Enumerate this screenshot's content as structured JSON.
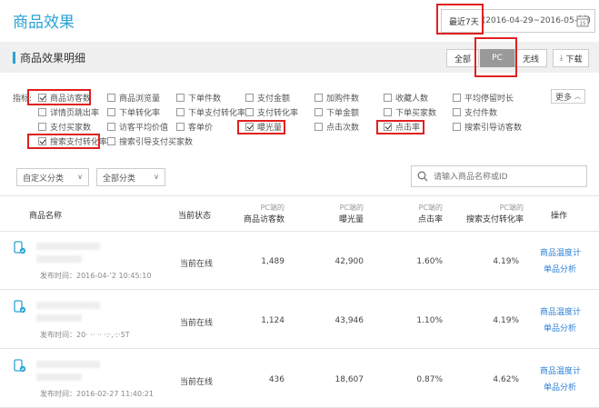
{
  "header": {
    "title": "商品效果",
    "date_selected": "最近7天",
    "date_range": "(2016-04-29~2016-05-05)",
    "calendar_day": "15"
  },
  "section": {
    "title": "商品效果明细",
    "tabs": [
      "全部",
      "PC",
      "无线"
    ],
    "download": "下载"
  },
  "metrics": {
    "label": "指标:",
    "more": "更多",
    "items": [
      {
        "label": "商品访客数",
        "checked": true
      },
      {
        "label": "商品浏览量",
        "checked": false
      },
      {
        "label": "下单件数",
        "checked": false
      },
      {
        "label": "支付金额",
        "checked": false
      },
      {
        "label": "加购件数",
        "checked": false
      },
      {
        "label": "收藏人数",
        "checked": false
      },
      {
        "label": "平均停留时长",
        "checked": false
      },
      {
        "label": "详情页跳出率",
        "checked": false
      },
      {
        "label": "下单转化率",
        "checked": false
      },
      {
        "label": "下单支付转化率",
        "checked": false
      },
      {
        "label": "支付转化率",
        "checked": false
      },
      {
        "label": "下单金额",
        "checked": false
      },
      {
        "label": "下单买家数",
        "checked": false
      },
      {
        "label": "支付件数",
        "checked": false
      },
      {
        "label": "支付买家数",
        "checked": false
      },
      {
        "label": "访客平均价值",
        "checked": false
      },
      {
        "label": "客单价",
        "checked": false
      },
      {
        "label": "曝光量",
        "checked": true
      },
      {
        "label": "点击次数",
        "checked": false
      },
      {
        "label": "点击率",
        "checked": true
      },
      {
        "label": "搜索引导访客数",
        "checked": false
      },
      {
        "label": "搜索支付转化率",
        "checked": true
      },
      {
        "label": "搜索引导支付买家数",
        "checked": false
      }
    ]
  },
  "filters": {
    "custom_category": "自定义分类",
    "all_category": "全部分类",
    "search_placeholder": "请输入商品名称或ID"
  },
  "table": {
    "columns": {
      "name": "商品名称",
      "status": "当前状态",
      "visitors": {
        "sub": "PC端的",
        "main": "商品访客数"
      },
      "exposure": {
        "sub": "PC端的",
        "main": "曝光量"
      },
      "ctr": {
        "sub": "PC端的",
        "main": "点击率"
      },
      "search_cvr": {
        "sub": "PC端的",
        "main": "搜索支付转化率"
      },
      "action": "操作"
    },
    "rows": [
      {
        "publish": "发布时间：2016-04-‘2 10:45:10",
        "status": "当前在线",
        "visitors": "1,489",
        "exposure": "42,900",
        "ctr": "1.60%",
        "search_cvr": "4.19%",
        "action1": "商品温度计",
        "action2": "单品分析"
      },
      {
        "publish": "发布时间：20·  ·· ·· ·:·,·:·5T",
        "status": "当前在线",
        "visitors": "1,124",
        "exposure": "43,946",
        "ctr": "1.10%",
        "search_cvr": "4.19%",
        "action1": "商品温度计",
        "action2": "单品分析"
      },
      {
        "publish": "发布时间：2016-02-27 11:40:21",
        "status": "当前在线",
        "visitors": "436",
        "exposure": "18,607",
        "ctr": "0.87%",
        "search_cvr": "4.62%",
        "action1": "商品温度计",
        "action2": "单品分析"
      }
    ]
  },
  "colors": {
    "accent": "#2ba3d4",
    "highlight": "#e02020",
    "link": "#2b7fd6"
  }
}
